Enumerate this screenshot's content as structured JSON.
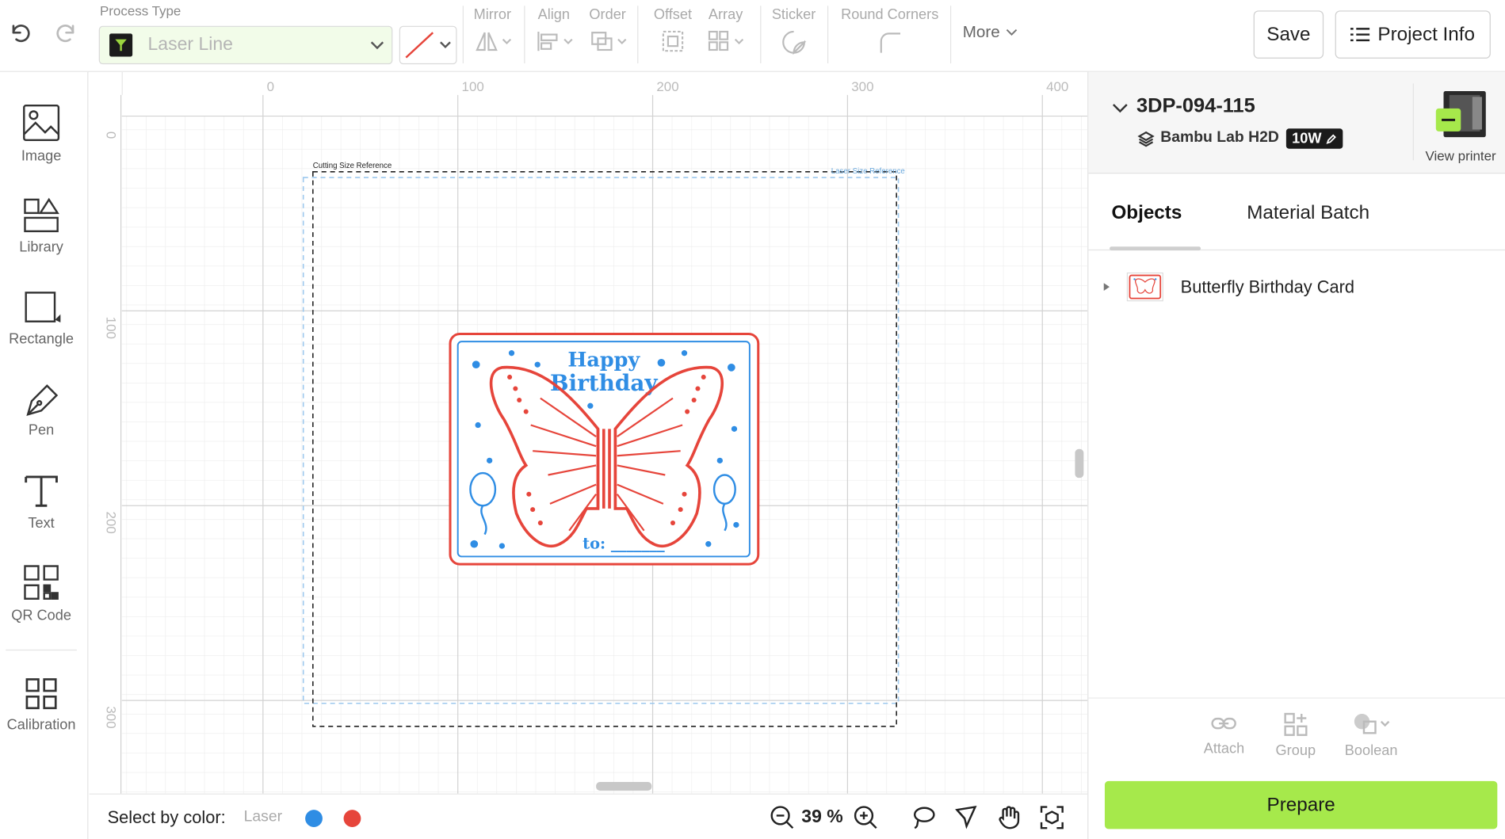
{
  "toolbar": {
    "process_type_label": "Process Type",
    "process_type_value": "Laser Line",
    "groups": {
      "mirror": "Mirror",
      "align": "Align",
      "order": "Order",
      "offset": "Offset",
      "array": "Array",
      "sticker": "Sticker",
      "round_corners": "Round Corners"
    },
    "more_label": "More",
    "save_label": "Save",
    "project_info_label": "Project Info"
  },
  "sidebar": {
    "items": [
      {
        "label": "Image",
        "icon": "image-icon"
      },
      {
        "label": "Library",
        "icon": "library-icon"
      },
      {
        "label": "Rectangle",
        "icon": "rectangle-icon"
      },
      {
        "label": "Pen",
        "icon": "pen-icon"
      },
      {
        "label": "Text",
        "icon": "text-icon"
      },
      {
        "label": "QR Code",
        "icon": "qr-code-icon"
      },
      {
        "label": "Calibration",
        "icon": "calibration-icon"
      }
    ]
  },
  "canvas": {
    "ruler_top": [
      "0",
      "100",
      "200",
      "300",
      "400"
    ],
    "ruler_left": [
      "0",
      "100",
      "200",
      "300"
    ],
    "cutting_ref_label": "Cutting Size Reference",
    "laser_ref_label": "Laser Size Reference",
    "design": {
      "line1": "Happy",
      "line2": "Birthday",
      "footer": "to: _______"
    },
    "colors": {
      "red_layer": "#e6453b",
      "blue_layer": "#2f8de4",
      "grid_minor": "#ececec",
      "grid_major": "#d4d4d4"
    }
  },
  "statusbar": {
    "select_by_color_label": "Select by color:",
    "laser_label": "Laser",
    "swatches": [
      "#2f8de4",
      "#e6453b"
    ],
    "zoom": "39 %"
  },
  "right_panel": {
    "project_name": "3DP-094-115",
    "printer_model": "Bambu Lab H2D",
    "laser_power": "10W",
    "view_printer_label": "View printer",
    "tabs": [
      "Objects",
      "Material Batch"
    ],
    "objects": [
      {
        "name": "Butterfly Birthday Card"
      }
    ],
    "bottom_tools": {
      "attach": "Attach",
      "group": "Group",
      "boolean": "Boolean"
    },
    "prepare_label": "Prepare",
    "accent_color": "#a6e94b"
  }
}
